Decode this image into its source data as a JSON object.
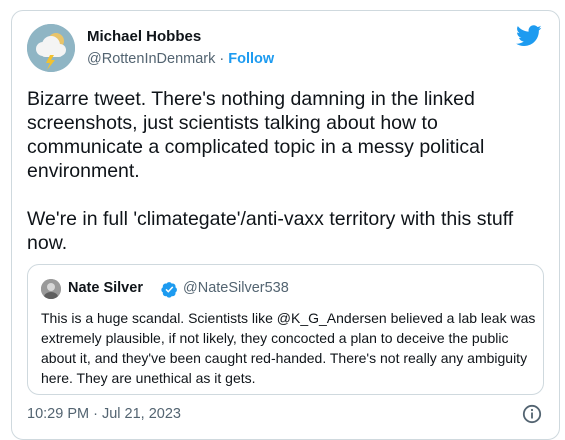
{
  "author": {
    "name": "Michael Hobbes",
    "handle": "@RottenInDenmark",
    "separator": "·",
    "follow_label": "Follow",
    "avatar_icon": "storm-cloud-avatar"
  },
  "tweet": {
    "paragraphs": [
      "Bizarre tweet. There's nothing damning in the linked screenshots, just scientists talking about how to communicate a complicated topic in a messy political environment.",
      "We're in full 'climategate'/anti-vaxx territory with this stuff now."
    ],
    "timestamp": "10:29 PM · Jul 21, 2023"
  },
  "quote": {
    "name": "Nate Silver",
    "handle": "@NateSilver538",
    "verified": true,
    "text": "This is a huge scandal. Scientists like @K_G_Andersen believed a lab leak was extremely plausible, if not likely, they concocted a plan to deceive the public about it, and they've been caught red-handed. There's not really any ambiguity here. They are unethical as it gets."
  },
  "icons": {
    "brand": "twitter-bird-icon",
    "verified": "verified-badge-icon",
    "info": "info-icon"
  },
  "colors": {
    "brand_blue": "#1d9bf0",
    "text": "#0f1419",
    "secondary_text": "#536471",
    "border": "#cfd9de"
  }
}
